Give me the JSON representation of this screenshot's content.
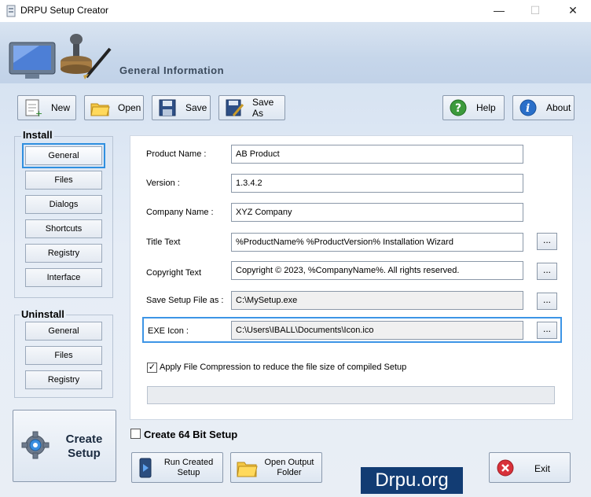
{
  "window": {
    "title": "DRPU Setup Creator",
    "minimize": "—",
    "maximize": "☐",
    "close": "✕"
  },
  "header": {
    "title": "General Information"
  },
  "toolbar": {
    "new_label": "New",
    "open_label": "Open",
    "save_label": "Save",
    "saveas_label": "Save As",
    "help_label": "Help",
    "about_label": "About"
  },
  "install": {
    "title": "Install",
    "items": [
      "General",
      "Files",
      "Dialogs",
      "Shortcuts",
      "Registry",
      "Interface"
    ]
  },
  "uninstall": {
    "title": "Uninstall",
    "items": [
      "General",
      "Files",
      "Registry"
    ]
  },
  "form": {
    "product_name": {
      "label": "Product Name :",
      "value": "AB Product"
    },
    "version": {
      "label": "Version :",
      "value": "1.3.4.2"
    },
    "company_name": {
      "label": "Company Name :",
      "value": "XYZ Company"
    },
    "title_text": {
      "label": "Title Text",
      "value": "%ProductName% %ProductVersion% Installation Wizard"
    },
    "copyright_text": {
      "label": "Copyright Text",
      "value": "Copyright © 2023, %CompanyName%. All rights reserved."
    },
    "save_setup": {
      "label": "Save Setup File as :",
      "value": "C:\\MySetup.exe"
    },
    "exe_icon": {
      "label": "EXE Icon :",
      "value": "C:\\Users\\IBALL\\Documents\\Icon.ico"
    },
    "browse_label": "...",
    "compression": {
      "label": "Apply File Compression to reduce the file size of compiled Setup",
      "checked": true,
      "mark": "✓"
    }
  },
  "bottom": {
    "create_setup_line1": "Create",
    "create_setup_line2": "Setup",
    "create64_label": "Create 64 Bit Setup",
    "create64_checked": false,
    "run_line1": "Run Created",
    "run_line2": "Setup",
    "open_line1": "Open Output",
    "open_line2": "Folder",
    "exit_label": "Exit"
  },
  "watermark": "Drpu.org",
  "colors": {
    "accent": "#3d95e6",
    "header": "#c6d6ea",
    "watermark_bg": "#123c73"
  }
}
